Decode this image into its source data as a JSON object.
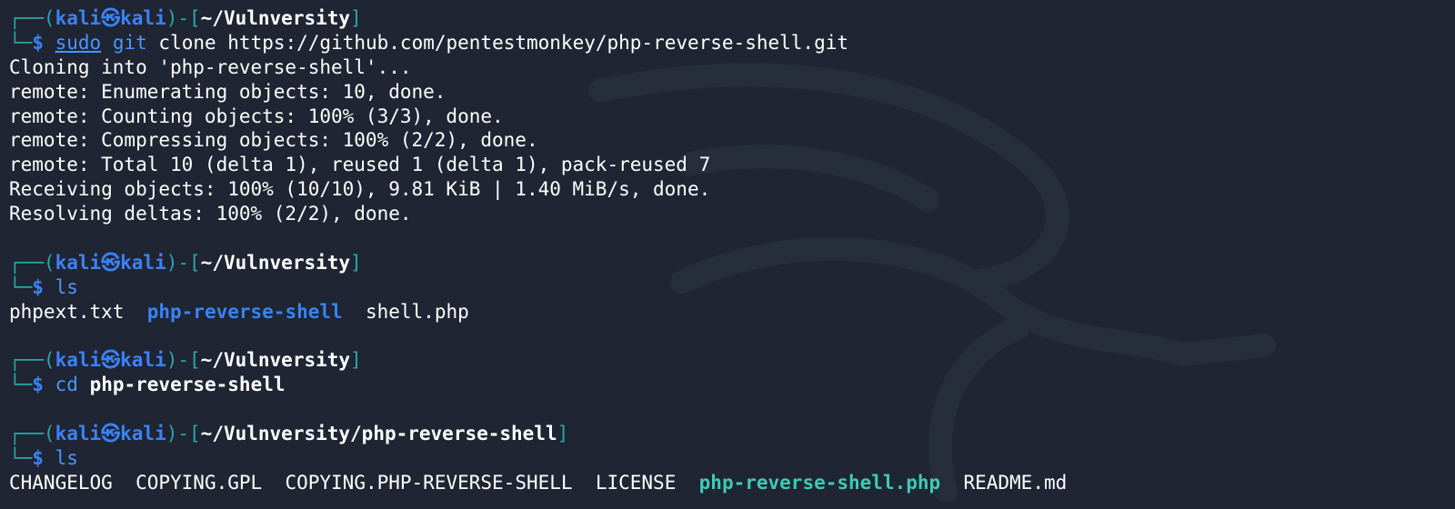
{
  "prompt": {
    "corner_top": "┌──(",
    "corner_bottom": "└─",
    "user_host": "kali㉿kali",
    "mid": ")-[",
    "close": "]",
    "dollar": "$"
  },
  "blocks": [
    {
      "path": "~/Vulnversity",
      "command": {
        "sudo": "sudo",
        "cmd": "git",
        "args": " clone https://github.com/pentestmonkey/php-reverse-shell.git"
      },
      "output": [
        "Cloning into 'php-reverse-shell'...",
        "remote: Enumerating objects: 10, done.",
        "remote: Counting objects: 100% (3/3), done.",
        "remote: Compressing objects: 100% (2/2), done.",
        "remote: Total 10 (delta 1), reused 1 (delta 1), pack-reused 7",
        "Receiving objects: 100% (10/10), 9.81 KiB | 1.40 MiB/s, done.",
        "Resolving deltas: 100% (2/2), done."
      ]
    },
    {
      "path": "~/Vulnversity",
      "command": {
        "cmd": "ls"
      },
      "listing": [
        {
          "name": "phpext.txt",
          "kind": "file"
        },
        {
          "name": "php-reverse-shell",
          "kind": "dir"
        },
        {
          "name": "shell.php",
          "kind": "file"
        }
      ]
    },
    {
      "path": "~/Vulnversity",
      "command": {
        "cmd": "cd",
        "args": "php-reverse-shell"
      }
    },
    {
      "path": "~/Vulnversity/php-reverse-shell",
      "command": {
        "cmd": "ls"
      },
      "listing": [
        {
          "name": "CHANGELOG",
          "kind": "file"
        },
        {
          "name": "COPYING.GPL",
          "kind": "file"
        },
        {
          "name": "COPYING.PHP-REVERSE-SHELL",
          "kind": "file"
        },
        {
          "name": "LICENSE",
          "kind": "file"
        },
        {
          "name": "php-reverse-shell.php",
          "kind": "exec"
        },
        {
          "name": "README.md",
          "kind": "file"
        }
      ]
    }
  ],
  "colors": {
    "background": "#1f2532",
    "prompt_frame": "#2aa7a7",
    "user": "#3b82f6",
    "command": "#4b95ff",
    "directory": "#3b82f6",
    "executable": "#3ec9b5"
  },
  "watermark_icon": "kali-dragon-icon"
}
